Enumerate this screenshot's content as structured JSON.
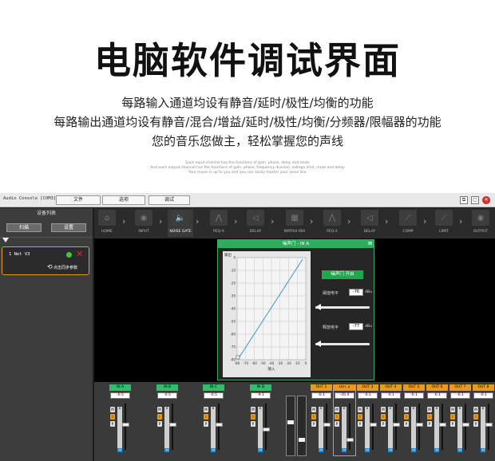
{
  "hero": {
    "title": "电脑软件调试界面",
    "line1": "每路输入通道均设有静音/延时/极性/均衡的功能",
    "line2": "每路输出通道均设有静音/混合/增益/延时/极性/均衡/分频器/限幅器的功能",
    "line3": "您的音乐您做主，轻松掌握您的声线",
    "tiny1": "Each input channel has the functions of gain, phase, delay and mute",
    "tiny2": "And each output channel has the functions of gain, phase, frequency division, voltage limit, mute and delay",
    "tiny3": "Your music is up to you and you can easily master your voice line"
  },
  "window": {
    "app_name": "Audio Console [COM3]",
    "menu": [
      "文件",
      "选项",
      "调试"
    ],
    "controls": [
      "⧉",
      "▢",
      "✕"
    ]
  },
  "sidebar": {
    "header": "设备列表",
    "scan_label": "扫描",
    "settings_label": "设置",
    "device_name": "1  Net V3",
    "sync_label": "点击同步参数"
  },
  "nav": {
    "items": [
      {
        "label": "HOME",
        "icon": "home-icon",
        "glyph": "⌂"
      },
      {
        "label": "INPUT",
        "icon": "input-icon",
        "glyph": "◉"
      },
      {
        "label": "NOISE GATE",
        "icon": "speaker-icon",
        "glyph": "🔈"
      },
      {
        "label": "PEQ-X",
        "icon": "peq-icon",
        "glyph": "⋀"
      },
      {
        "label": "DELAY",
        "icon": "delay-icon",
        "glyph": "◁"
      },
      {
        "label": "MATRIX MIX",
        "icon": "matrix-icon",
        "glyph": "▦"
      },
      {
        "label": "PEQ-X",
        "icon": "peq-icon",
        "glyph": "⋀"
      },
      {
        "label": "DELAY",
        "icon": "delay-icon",
        "glyph": "◁"
      },
      {
        "label": "COMP",
        "icon": "comp-icon",
        "glyph": "⟋"
      },
      {
        "label": "LIMIT",
        "icon": "limit-icon",
        "glyph": "⟋"
      },
      {
        "label": "OUTPUT",
        "icon": "output-icon",
        "glyph": "◉"
      }
    ],
    "active_index": 2
  },
  "dialog": {
    "title": "噪声门 - IN A",
    "close": "⊠",
    "gate_button": "噪声门 开启",
    "threshold_label": "阈值电平",
    "threshold_value": "-76",
    "threshold_unit": "dBu",
    "release_label": "释放电平",
    "release_value": "-77",
    "release_unit": "dBu",
    "graph": {
      "ylabel": "输出",
      "xlabel": "输入",
      "y_ticks": [
        "0",
        "-10",
        "-20",
        "-30",
        "-40",
        "-50",
        "-60",
        "-70",
        "-80"
      ],
      "x_ticks": [
        "-80",
        "-70",
        "-60",
        "-50",
        "-40",
        "-30",
        "-20",
        "-10",
        "0"
      ]
    }
  },
  "inputs": [
    {
      "label": "IN A",
      "value": "-0.5",
      "fader": 0.55
    },
    {
      "label": "IN B",
      "value": "-0.5",
      "fader": 0.55
    },
    {
      "label": "IN C",
      "value": "-0.5",
      "fader": 0.55
    },
    {
      "label": "IN D",
      "value": "-9.1",
      "fader": 0.45
    }
  ],
  "outputs": [
    {
      "label": "OUT 1",
      "value": "-0.1",
      "fader": 0.55
    },
    {
      "label": "OUT 2",
      "value": "-35.4",
      "fader": 0.2
    },
    {
      "label": "OUT 3",
      "value": "-0.1",
      "fader": 0.55
    },
    {
      "label": "OUT 4",
      "value": "-0.1",
      "fader": 0.55
    },
    {
      "label": "OUT 5",
      "value": "-0.1",
      "fader": 0.55
    },
    {
      "label": "OUT 6",
      "value": "-0.1",
      "fader": 0.55
    },
    {
      "label": "OUT 7",
      "value": "-0.1",
      "fader": 0.55
    },
    {
      "label": "OUT 8",
      "value": "-0.1",
      "fader": 0.55
    }
  ],
  "strip_buttons": [
    "M",
    "I",
    "P"
  ],
  "scale_top": "6",
  "scale_bottom": "-64",
  "colors": {
    "input_accent": "#2fbe6a",
    "output_accent": "#e89a1a",
    "gate_green": "#1ea850"
  }
}
